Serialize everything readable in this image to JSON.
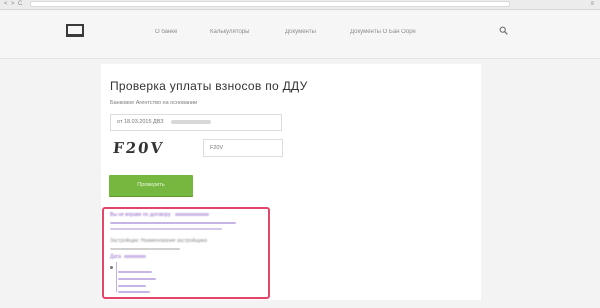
{
  "browser": {
    "back_glyph": "<",
    "forward_glyph": ">",
    "reload_glyph": "C",
    "url": "",
    "menu_glyph": "≡"
  },
  "header": {
    "logo_text": "",
    "nav": [
      {
        "label": "О банке"
      },
      {
        "label": "Калькуляторы"
      },
      {
        "label": "Документы"
      },
      {
        "label": "Документы О Бан Ооре"
      }
    ]
  },
  "form": {
    "title": "Проверка уплаты взносов по ДДУ",
    "contract_label": "Банковое Агентство на основании",
    "contract_value": "от 18.03.2015 ДВЗ",
    "captcha_text": "F20V",
    "captcha_value": "F20V",
    "submit_label": "Проверить"
  },
  "result": {
    "line1": "Вы не вправе по договору",
    "line2": "Застройщик: Наименование застройщика",
    "line3": "Дата"
  },
  "colors": {
    "accent_green": "#76b83f",
    "highlight_red": "#e2466a",
    "link_purple": "#8d64c8"
  }
}
